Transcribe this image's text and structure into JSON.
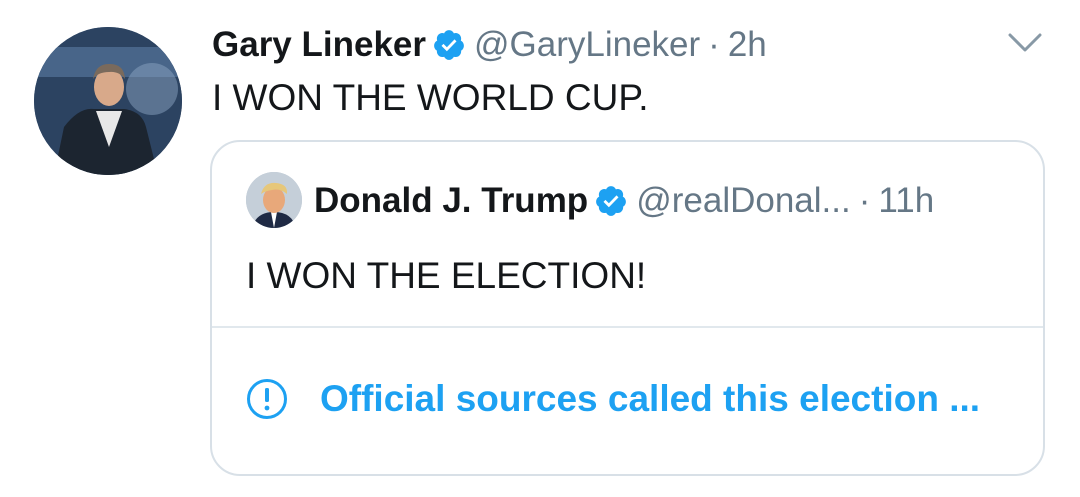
{
  "tweet": {
    "author_name": "Gary Lineker",
    "author_handle": "@GaryLineker",
    "separator": "·",
    "time": "2h",
    "text": "I WON THE WORLD CUP.",
    "avatar_icon": "profile-photo",
    "verified_icon": "verified-badge-icon",
    "menu_icon": "chevron-down-icon"
  },
  "quoted_tweet": {
    "author_name": "Donald J. Trump",
    "author_handle": "@realDonal...",
    "separator": "·",
    "time": "11h",
    "text": "I WON THE ELECTION!",
    "avatar_icon": "profile-photo",
    "verified_icon": "verified-badge-icon",
    "notice_icon": "exclamation-circle-icon",
    "notice_text": "Official sources called this election ..."
  },
  "colors": {
    "accent": "#1da1f2",
    "text_primary": "#14171a",
    "text_secondary": "#657786",
    "border": "#d8e0e7"
  }
}
